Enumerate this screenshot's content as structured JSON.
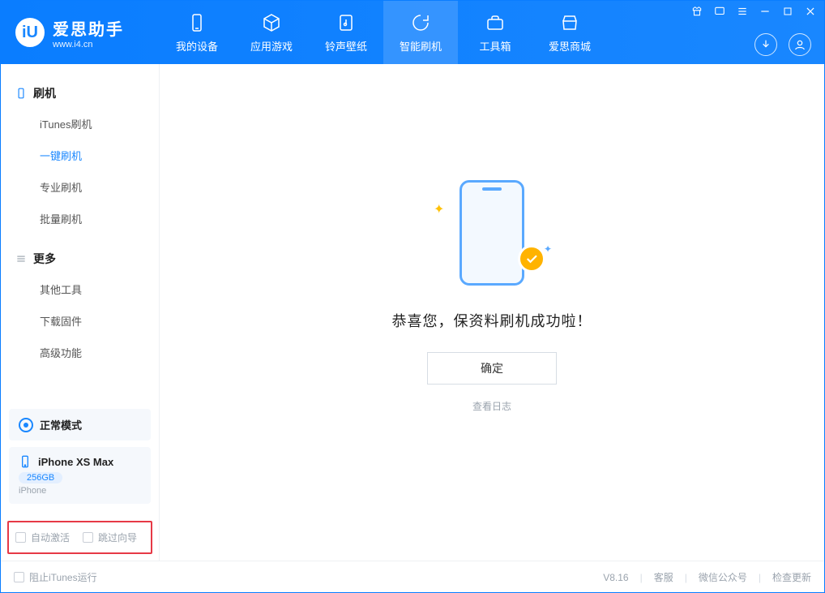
{
  "app": {
    "title": "爱思助手",
    "url": "www.i4.cn"
  },
  "nav": {
    "items": [
      {
        "label": "我的设备"
      },
      {
        "label": "应用游戏"
      },
      {
        "label": "铃声壁纸"
      },
      {
        "label": "智能刷机"
      },
      {
        "label": "工具箱"
      },
      {
        "label": "爱思商城"
      }
    ]
  },
  "sidebar": {
    "flash_title": "刷机",
    "more_title": "更多",
    "flash_items": [
      {
        "label": "iTunes刷机"
      },
      {
        "label": "一键刷机"
      },
      {
        "label": "专业刷机"
      },
      {
        "label": "批量刷机"
      }
    ],
    "more_items": [
      {
        "label": "其他工具"
      },
      {
        "label": "下载固件"
      },
      {
        "label": "高级功能"
      }
    ],
    "mode_label": "正常模式",
    "device_name": "iPhone XS Max",
    "device_capacity": "256GB",
    "device_type": "iPhone",
    "chk_auto_activate": "自动激活",
    "chk_skip_guide": "跳过向导"
  },
  "main": {
    "success_msg": "恭喜您，保资料刷机成功啦！",
    "ok_label": "确定",
    "log_link": "查看日志"
  },
  "footer": {
    "block_itunes": "阻止iTunes运行",
    "version": "V8.16",
    "links": [
      {
        "label": "客服"
      },
      {
        "label": "微信公众号"
      },
      {
        "label": "检查更新"
      }
    ]
  }
}
